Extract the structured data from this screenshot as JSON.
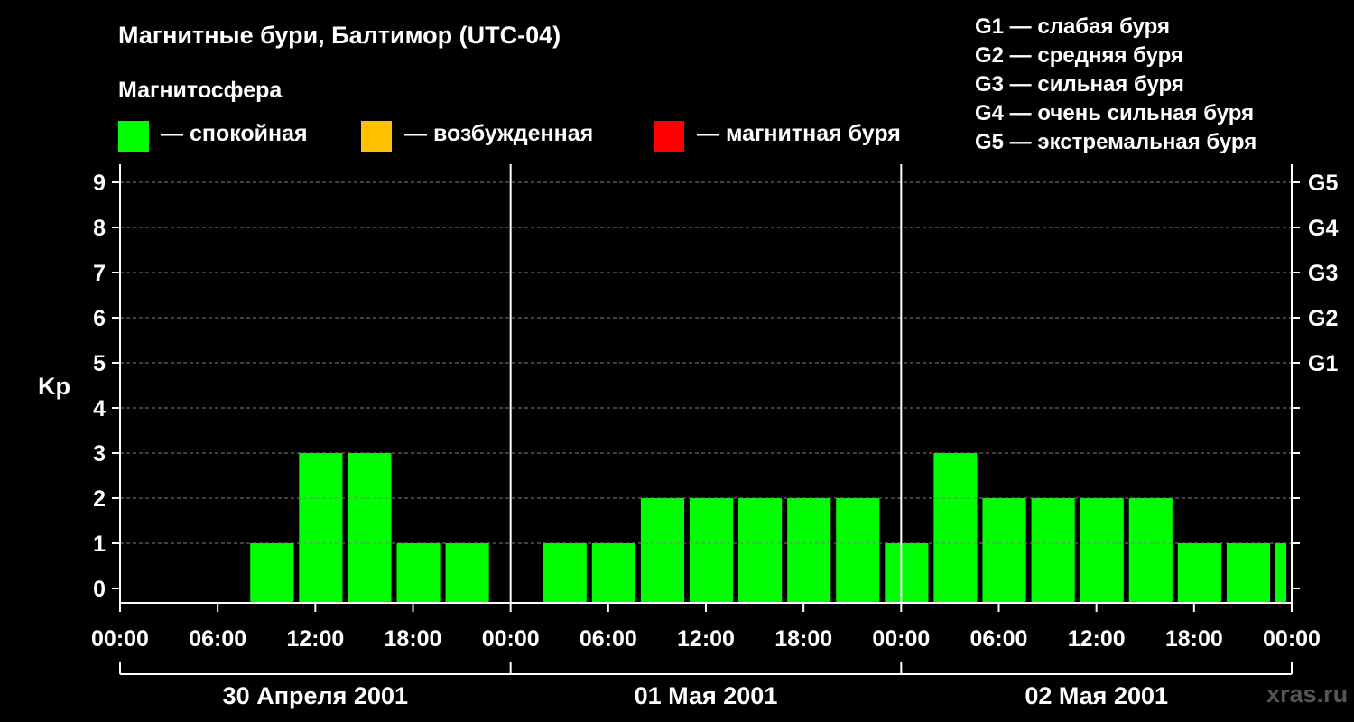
{
  "legend_heading": "Магнитосфера",
  "legend": [
    {
      "label": "— спокойная",
      "color": "#00ff00"
    },
    {
      "label": "— возбужденная",
      "color": "#ffc000"
    },
    {
      "label": "— магнитная буря",
      "color": "#ff0000"
    }
  ],
  "g_scale": [
    "G1 — слабая буря",
    "G2 — средняя буря",
    "G3 — сильная буря",
    "G4 — очень сильная буря",
    "G5 — экстремальная буря"
  ],
  "watermark": "xras.ru",
  "chart_data": {
    "type": "bar",
    "title": "Магнитные бури, Балтимор (UTC-04)",
    "ylabel": "Kp",
    "ylim": [
      0,
      9
    ],
    "yticks": [
      0,
      1,
      2,
      3,
      4,
      5,
      6,
      7,
      8,
      9
    ],
    "right_axis_ticks": [
      {
        "kp": 5,
        "label": "G1"
      },
      {
        "kp": 6,
        "label": "G2"
      },
      {
        "kp": 7,
        "label": "G3"
      },
      {
        "kp": 8,
        "label": "G4"
      },
      {
        "kp": 9,
        "label": "G5"
      }
    ],
    "x_tick_labels": [
      "00:00",
      "06:00",
      "12:00",
      "18:00",
      "00:00",
      "06:00",
      "12:00",
      "18:00",
      "00:00",
      "06:00",
      "12:00",
      "18:00",
      "00:00"
    ],
    "x_range_hours": [
      0,
      72
    ],
    "days": [
      "30 Апреля 2001",
      "01 Мая 2001",
      "02 Мая 2001"
    ],
    "grid": true,
    "bars": [
      {
        "start_hour": 8,
        "end_hour": 10.67,
        "kp": 1
      },
      {
        "start_hour": 11,
        "end_hour": 13.67,
        "kp": 3
      },
      {
        "start_hour": 14,
        "end_hour": 16.67,
        "kp": 3
      },
      {
        "start_hour": 17,
        "end_hour": 19.67,
        "kp": 1
      },
      {
        "start_hour": 20,
        "end_hour": 22.67,
        "kp": 1
      },
      {
        "start_hour": 26,
        "end_hour": 28.67,
        "kp": 1
      },
      {
        "start_hour": 29,
        "end_hour": 31.67,
        "kp": 1
      },
      {
        "start_hour": 32,
        "end_hour": 34.67,
        "kp": 2
      },
      {
        "start_hour": 35,
        "end_hour": 37.67,
        "kp": 2
      },
      {
        "start_hour": 38,
        "end_hour": 40.67,
        "kp": 2
      },
      {
        "start_hour": 41,
        "end_hour": 43.67,
        "kp": 2
      },
      {
        "start_hour": 44,
        "end_hour": 46.67,
        "kp": 2
      },
      {
        "start_hour": 47,
        "end_hour": 49.67,
        "kp": 1
      },
      {
        "start_hour": 50,
        "end_hour": 52.67,
        "kp": 3
      },
      {
        "start_hour": 53,
        "end_hour": 55.67,
        "kp": 2
      },
      {
        "start_hour": 56,
        "end_hour": 58.67,
        "kp": 2
      },
      {
        "start_hour": 59,
        "end_hour": 61.67,
        "kp": 2
      },
      {
        "start_hour": 62,
        "end_hour": 64.67,
        "kp": 2
      },
      {
        "start_hour": 65,
        "end_hour": 67.67,
        "kp": 1
      },
      {
        "start_hour": 68,
        "end_hour": 70.67,
        "kp": 1
      },
      {
        "start_hour": 71,
        "end_hour": 71.67,
        "kp": 1
      }
    ],
    "bar_color": "#00ff00"
  }
}
